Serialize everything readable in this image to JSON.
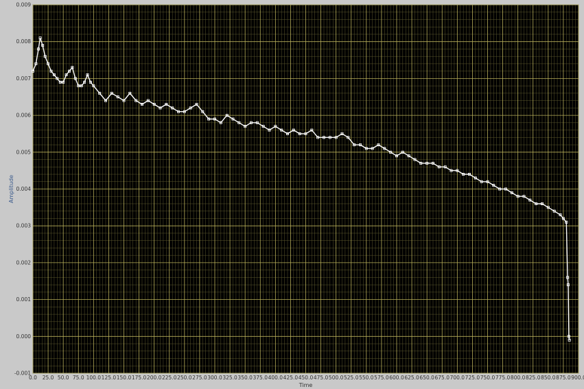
{
  "chart_data": {
    "type": "scatter",
    "title": "",
    "xlabel": "Time",
    "ylabel": "Amplitude",
    "xlim": [
      0,
      900
    ],
    "ylim": [
      -0.001,
      0.009
    ],
    "grid": true,
    "minor_grid": true,
    "legend": "none",
    "colors": {
      "plot_background": "#000000",
      "major_grid": "#b9b05a",
      "minor_grid": "#5e5a2e",
      "series": "#ffffff",
      "frame": "#c9c9c9"
    },
    "x_ticks": [
      "0.0",
      "25.0",
      "50.0",
      "75.0",
      "100.0",
      "125.0",
      "150.0",
      "175.0",
      "200.0",
      "225.0",
      "250.0",
      "275.0",
      "300.0",
      "325.0",
      "350.0",
      "375.0",
      "400.0",
      "425.0",
      "450.0",
      "475.0",
      "500.0",
      "525.0",
      "550.0",
      "575.0",
      "600.0",
      "625.0",
      "650.0",
      "675.0",
      "700.0",
      "725.0",
      "750.0",
      "775.0",
      "800.0",
      "825.0",
      "850.0",
      "875.0",
      "900.0"
    ],
    "y_ticks": [
      "-0.001",
      "0.000",
      "0.001",
      "0.002",
      "0.003",
      "0.004",
      "0.005",
      "0.006",
      "0.007",
      "0.008",
      "0.009"
    ],
    "series": [
      {
        "x": [
          0,
          5,
          9,
          12,
          16,
          20,
          25,
          30,
          35,
          40,
          45,
          50,
          55,
          60,
          65,
          70,
          75,
          80,
          85,
          90,
          95,
          100,
          110,
          120,
          130,
          140,
          150,
          160,
          170,
          180,
          190,
          200,
          210,
          220,
          230,
          240,
          250,
          260,
          270,
          280,
          290,
          300,
          310,
          320,
          330,
          340,
          350,
          360,
          370,
          380,
          390,
          400,
          410,
          420,
          430,
          440,
          450,
          460,
          470,
          480,
          490,
          500,
          510,
          520,
          530,
          540,
          550,
          560,
          570,
          580,
          590,
          600,
          610,
          620,
          630,
          640,
          650,
          660,
          670,
          680,
          690,
          700,
          710,
          720,
          730,
          740,
          750,
          760,
          770,
          780,
          790,
          800,
          810,
          820,
          830,
          840,
          850,
          860,
          870,
          875,
          880,
          882,
          883,
          884,
          885
        ],
        "y": [
          0.0072,
          0.0074,
          0.0078,
          0.0081,
          0.0079,
          0.0076,
          0.0074,
          0.0072,
          0.0071,
          0.007,
          0.0069,
          0.0069,
          0.0071,
          0.0072,
          0.0073,
          0.007,
          0.0068,
          0.0068,
          0.0069,
          0.0071,
          0.0069,
          0.0068,
          0.0066,
          0.0064,
          0.0066,
          0.0065,
          0.0064,
          0.0066,
          0.0064,
          0.0063,
          0.0064,
          0.0063,
          0.0062,
          0.0063,
          0.0062,
          0.0061,
          0.0061,
          0.0062,
          0.0063,
          0.0061,
          0.0059,
          0.0059,
          0.0058,
          0.006,
          0.0059,
          0.0058,
          0.0057,
          0.0058,
          0.0058,
          0.0057,
          0.0056,
          0.0057,
          0.0056,
          0.0055,
          0.0056,
          0.0055,
          0.0055,
          0.0056,
          0.0054,
          0.0054,
          0.0054,
          0.0054,
          0.0055,
          0.0054,
          0.0052,
          0.0052,
          0.0051,
          0.0051,
          0.0052,
          0.0051,
          0.005,
          0.0049,
          0.005,
          0.0049,
          0.0048,
          0.0047,
          0.0047,
          0.0047,
          0.0046,
          0.0046,
          0.0045,
          0.0045,
          0.0044,
          0.0044,
          0.0043,
          0.0042,
          0.0042,
          0.0041,
          0.004,
          0.004,
          0.0039,
          0.0038,
          0.0038,
          0.0037,
          0.0036,
          0.0036,
          0.0035,
          0.0034,
          0.0033,
          0.0032,
          0.0031,
          0.0016,
          0.0014,
          0.0,
          -0.0001
        ]
      }
    ]
  }
}
